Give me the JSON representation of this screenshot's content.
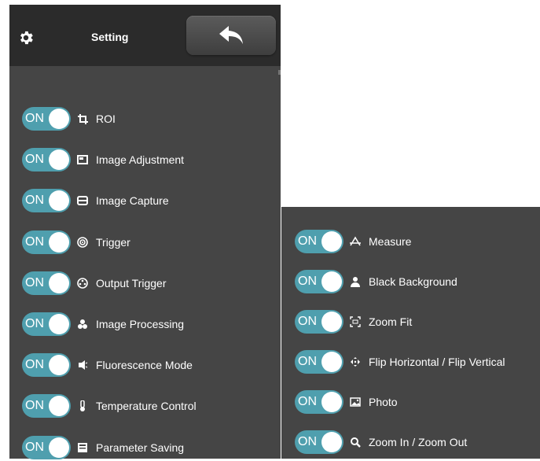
{
  "header": {
    "title": "Setting"
  },
  "toggle_text": "ON",
  "colors": {
    "toggle_on": "#4f9fae",
    "panel": "#454545",
    "header": "#2b2b2b"
  },
  "left_items": [
    {
      "label": "ROI",
      "icon": "crop-icon",
      "state": "ON"
    },
    {
      "label": "Image Adjustment",
      "icon": "image-adjustment-icon",
      "state": "ON"
    },
    {
      "label": "Image Capture",
      "icon": "capture-icon",
      "state": "ON"
    },
    {
      "label": "Trigger",
      "icon": "trigger-icon",
      "state": "ON"
    },
    {
      "label": "Output Trigger",
      "icon": "output-trigger-icon",
      "state": "ON"
    },
    {
      "label": "Image Processing",
      "icon": "image-processing-icon",
      "state": "ON"
    },
    {
      "label": "Fluorescence Mode",
      "icon": "fluorescence-icon",
      "state": "ON"
    },
    {
      "label": "Temperature Control",
      "icon": "thermometer-icon",
      "state": "ON"
    },
    {
      "label": "Parameter Saving",
      "icon": "save-parameters-icon",
      "state": "ON"
    }
  ],
  "right_items": [
    {
      "label": "Measure",
      "icon": "measure-icon",
      "state": "ON"
    },
    {
      "label": "Black Background",
      "icon": "person-icon",
      "state": "ON"
    },
    {
      "label": "Zoom Fit",
      "icon": "zoom-fit-icon",
      "state": "ON"
    },
    {
      "label": "Flip Horizontal / Flip Vertical",
      "icon": "flip-icon",
      "state": "ON"
    },
    {
      "label": "Photo",
      "icon": "photo-icon",
      "state": "ON"
    },
    {
      "label": "Zoom In / Zoom Out",
      "icon": "zoom-icon",
      "state": "ON"
    }
  ]
}
